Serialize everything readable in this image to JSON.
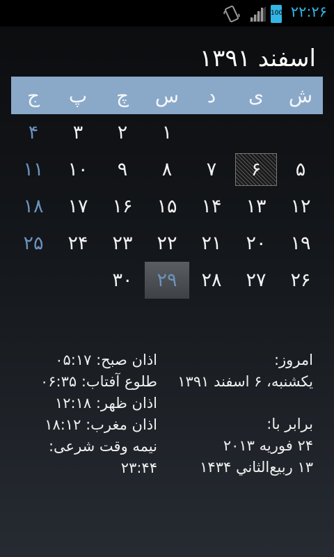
{
  "status_bar": {
    "time": "۲۲:۲۶",
    "battery_label": "100",
    "icons": [
      "vibrate-icon",
      "signal-icon",
      "battery-icon"
    ],
    "accent_color": "#33b5e5"
  },
  "calendar": {
    "month_title": "اسفند ۱۳۹۱",
    "weekdays": [
      "ش",
      "ی",
      "د",
      "س",
      "چ",
      "پ",
      "ج"
    ],
    "header_color": "#8aa9c9",
    "friday_color": "#6b93bd",
    "weeks": [
      [
        "",
        "",
        "",
        "۱",
        "۲",
        "۳",
        "۴"
      ],
      [
        "۵",
        "۶",
        "۷",
        "۸",
        "۹",
        "۱۰",
        "۱۱"
      ],
      [
        "۱۲",
        "۱۳",
        "۱۴",
        "۱۵",
        "۱۶",
        "۱۷",
        "۱۸"
      ],
      [
        "۱۹",
        "۲۰",
        "۲۱",
        "۲۲",
        "۲۳",
        "۲۴",
        "۲۵"
      ],
      [
        "۲۶",
        "۲۷",
        "۲۸",
        "۲۹",
        "۳۰",
        "",
        ""
      ]
    ],
    "selected_day": "۶",
    "highlighted_day": "۲۹"
  },
  "info": {
    "today_label": "امروز:",
    "today_value": "یکشنبه، ۶ اسفند ۱۳۹۱",
    "equal_label": "برابر با:",
    "gregorian": "۲۴ فوریه ۲۰۱۳",
    "hijri": "۱۳ ربیع‌الثاني ۱۴۳۴",
    "prayer_times": [
      "اذان صبح: ۰۵:۱۷",
      "طلوع آفتاب: ۰۶:۳۵",
      "اذان ظهر: ۱۲:۱۸",
      "اذان مغرب: ۱۸:۱۲",
      "نیمه وقت شرعی: ۲۳:۴۴"
    ]
  }
}
